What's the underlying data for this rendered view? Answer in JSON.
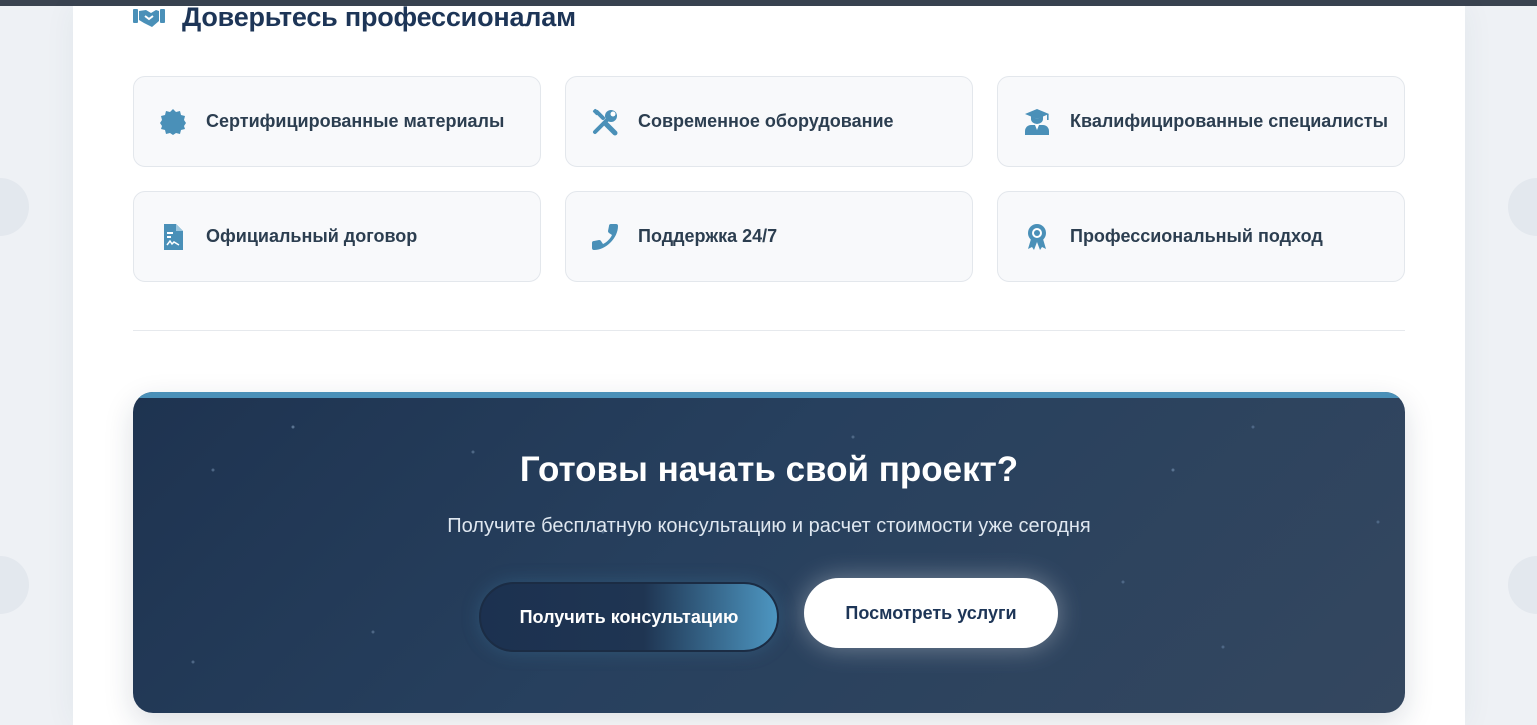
{
  "section": {
    "title": "Доверьтесь профессионалам",
    "icon": "handshake-icon"
  },
  "features": [
    {
      "label": "Сертифицированные материалы",
      "icon": "certificate-badge-icon"
    },
    {
      "label": "Современное оборудование",
      "icon": "tools-icon"
    },
    {
      "label": "Квалифицированные специалисты",
      "icon": "graduate-user-icon"
    },
    {
      "label": "Официальный договор",
      "icon": "contract-document-icon"
    },
    {
      "label": "Поддержка 24/7",
      "icon": "phone-icon"
    },
    {
      "label": "Профессиональный подход",
      "icon": "award-icon"
    }
  ],
  "cta": {
    "title": "Готовы начать свой проект?",
    "subtitle": "Получите бесплатную консультацию и расчет стоимости уже сегодня",
    "primary_button": "Получить консультацию",
    "secondary_button": "Посмотреть услуги"
  },
  "colors": {
    "accent": "#4a90b8",
    "heading": "#1d3557",
    "cta_background": "#1e3350",
    "icon": "#4a90b8"
  }
}
